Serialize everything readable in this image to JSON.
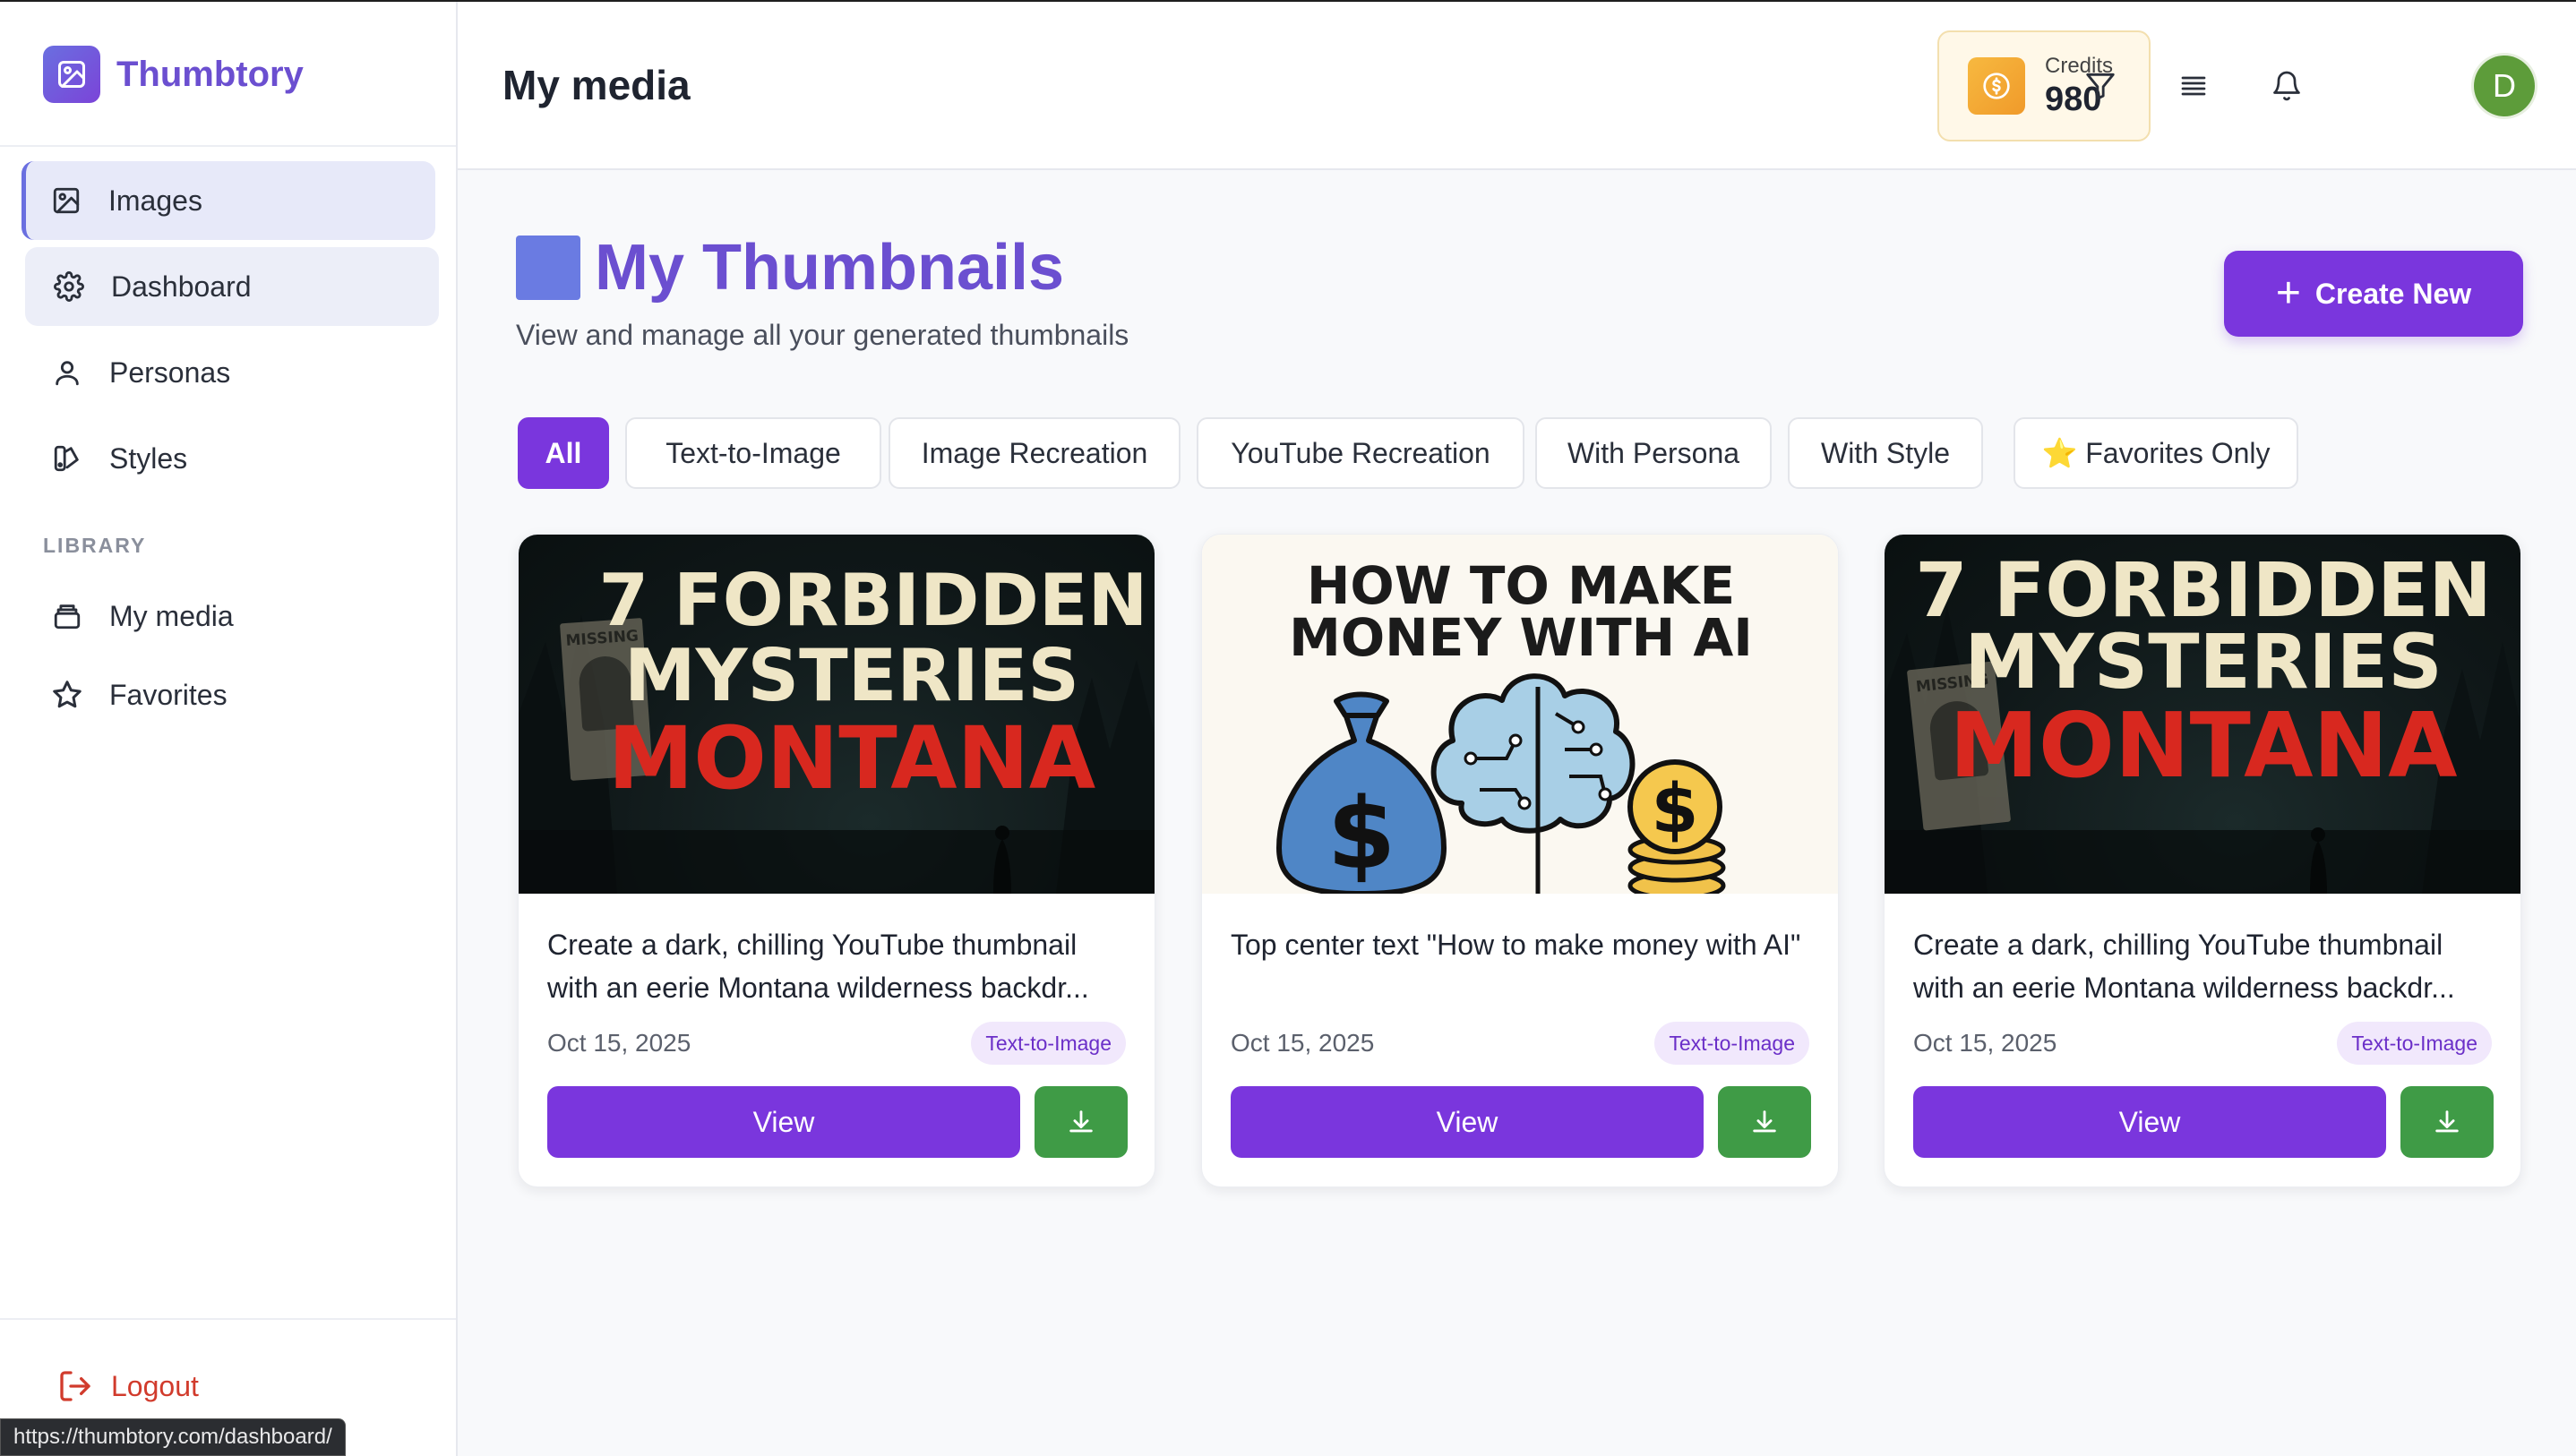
{
  "app": {
    "name": "Thumbtory"
  },
  "sidebar": {
    "items": [
      {
        "label": "Images",
        "icon": "image-icon"
      },
      {
        "label": "Dashboard",
        "icon": "gear-icon"
      },
      {
        "label": "Personas",
        "icon": "user-icon"
      },
      {
        "label": "Styles",
        "icon": "palette-icon"
      }
    ],
    "section_label": "LIBRARY",
    "library_items": [
      {
        "label": "My media",
        "icon": "stack-icon"
      },
      {
        "label": "Favorites",
        "icon": "star-icon"
      }
    ],
    "logout_label": "Logout"
  },
  "status_bar": {
    "url": "https://thumbtory.com/dashboard/"
  },
  "header": {
    "title": "My media",
    "credits_label": "Credits",
    "credits_value": "980",
    "avatar_initial": "D"
  },
  "main": {
    "title": "My Thumbnails",
    "subtitle": "View and manage all your generated thumbnails",
    "create_label": "Create New",
    "filters": [
      "All",
      "Text-to-Image",
      "Image Recreation",
      "YouTube Recreation",
      "With Persona",
      "With Style",
      "⭐ Favorites Only"
    ],
    "active_filter": "All"
  },
  "cards": [
    {
      "thumb_lines": [
        "7 FORBIDDEN",
        "MYSTERIES",
        "MONTANA"
      ],
      "poster_text": "MISSING",
      "prompt": "Create a dark, chilling YouTube thumbnail with an eerie Montana wilderness backdr...",
      "date": "Oct 15, 2025",
      "tag": "Text-to-Image",
      "view_label": "View"
    },
    {
      "thumb_lines": [
        "HOW TO MAKE",
        "MONEY WITH AI"
      ],
      "prompt": "Top center text \"How to make money with AI\"",
      "date": "Oct 15, 2025",
      "tag": "Text-to-Image",
      "view_label": "View"
    },
    {
      "thumb_lines": [
        "7 FORBIDDEN",
        "MYSTERIES",
        "MONTANA"
      ],
      "poster_text": "MISSING",
      "prompt": "Create a dark, chilling YouTube thumbnail with an eerie Montana wilderness backdr...",
      "date": "Oct 15, 2025",
      "tag": "Text-to-Image",
      "view_label": "View"
    }
  ],
  "colors": {
    "accent": "#7a36dd",
    "brand": "#6b4fd0",
    "download": "#3f9b46",
    "logout": "#d13b2c",
    "montana_red": "#d8281f",
    "cream_text": "#efe6c6"
  }
}
